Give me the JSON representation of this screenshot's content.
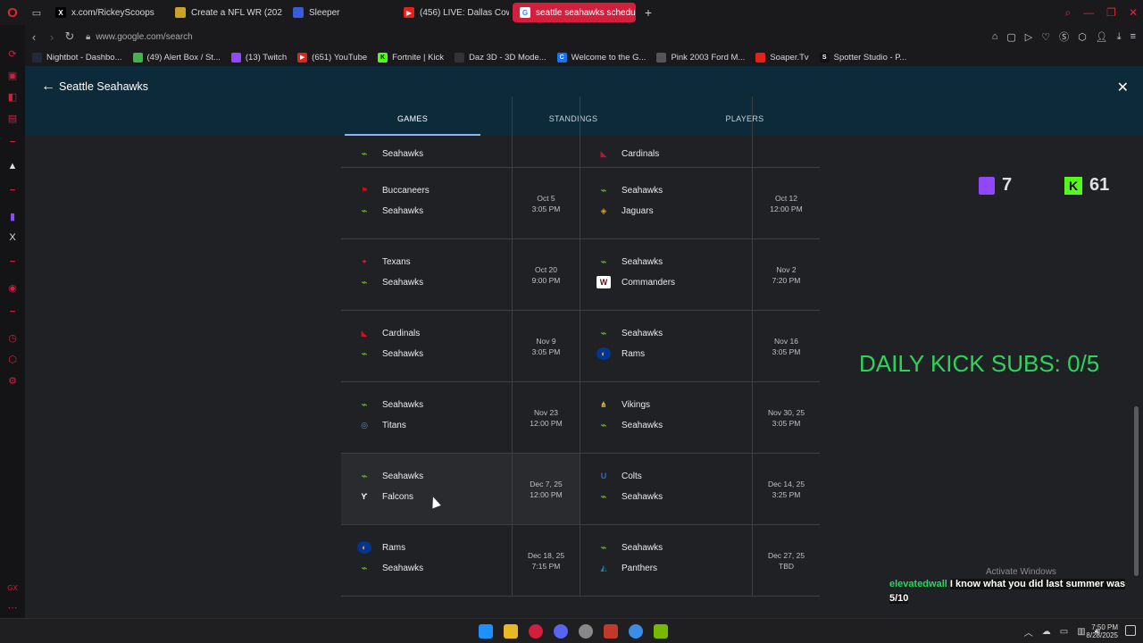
{
  "browser": {
    "tabs": [
      {
        "label": "x.com/RickeyScoops",
        "icon": "x-logo-icon",
        "color": "#000000",
        "glyph": "X",
        "active": false
      },
      {
        "label": "Create a NFL WR (2025-2",
        "icon": "yellow-tab-icon",
        "color": "#c9a227",
        "glyph": "",
        "active": false
      },
      {
        "label": "Sleeper",
        "icon": "sleeper-icon",
        "color": "#3a5bd6",
        "glyph": "",
        "active": false
      },
      {
        "label": "(456) LIVE: Dallas Cowbo",
        "icon": "youtube-icon",
        "color": "#e62117",
        "glyph": "▶",
        "active": false
      },
      {
        "label": "seattle seahawks schedul",
        "icon": "google-icon",
        "color": "#ffffff",
        "glyph": "G",
        "active": true
      }
    ],
    "url": "www.google.com/search",
    "bookmarks": [
      {
        "label": "Nightbot - Dashbo...",
        "color": "#222a3a",
        "glyph": ""
      },
      {
        "label": "(49) Alert Box / St...",
        "color": "#42b549",
        "glyph": ""
      },
      {
        "label": "(13) Twitch",
        "color": "#9146ff",
        "glyph": ""
      },
      {
        "label": "(651) YouTube",
        "color": "#e62117",
        "glyph": "▶"
      },
      {
        "label": "Fortnite | Kick",
        "color": "#53fc18",
        "glyph": "K"
      },
      {
        "label": "Daz 3D - 3D Mode...",
        "color": "#333333",
        "glyph": ""
      },
      {
        "label": "Welcome to the G...",
        "color": "#1a73e8",
        "glyph": "C"
      },
      {
        "label": "Pink 2003 Ford M...",
        "color": "#555555",
        "glyph": ""
      },
      {
        "label": "Soaper.Tv",
        "color": "#e62117",
        "glyph": ""
      },
      {
        "label": "Spotter Studio - P...",
        "color": "#111111",
        "glyph": "S"
      }
    ]
  },
  "panel": {
    "title": "Seattle Seahawks",
    "tabs": [
      "GAMES",
      "STANDINGS",
      "PLAYERS"
    ],
    "active_tab": "GAMES"
  },
  "games": [
    {
      "left": {
        "teams": [
          {
            "name": "Seahawks",
            "logo": "sea"
          }
        ],
        "date": "",
        "time": ""
      },
      "right": {
        "teams": [
          {
            "name": "Cardinals",
            "logo": "ari"
          }
        ],
        "date": "",
        "time": ""
      },
      "partial": true
    },
    {
      "left": {
        "teams": [
          {
            "name": "Buccaneers",
            "logo": "tb"
          },
          {
            "name": "Seahawks",
            "logo": "sea"
          }
        ],
        "date": "Oct 5",
        "time": "3:05 PM"
      },
      "right": {
        "teams": [
          {
            "name": "Seahawks",
            "logo": "sea"
          },
          {
            "name": "Jaguars",
            "logo": "jax"
          }
        ],
        "date": "Oct 12",
        "time": "12:00 PM"
      }
    },
    {
      "left": {
        "teams": [
          {
            "name": "Texans",
            "logo": "hou"
          },
          {
            "name": "Seahawks",
            "logo": "sea"
          }
        ],
        "date": "Oct 20",
        "time": "9:00 PM"
      },
      "right": {
        "teams": [
          {
            "name": "Seahawks",
            "logo": "sea"
          },
          {
            "name": "Commanders",
            "logo": "was"
          }
        ],
        "date": "Nov 2",
        "time": "7:20 PM"
      }
    },
    {
      "left": {
        "teams": [
          {
            "name": "Cardinals",
            "logo": "ari"
          },
          {
            "name": "Seahawks",
            "logo": "sea"
          }
        ],
        "date": "Nov 9",
        "time": "3:05 PM"
      },
      "right": {
        "teams": [
          {
            "name": "Seahawks",
            "logo": "sea"
          },
          {
            "name": "Rams",
            "logo": "lar"
          }
        ],
        "date": "Nov 16",
        "time": "3:05 PM"
      }
    },
    {
      "left": {
        "teams": [
          {
            "name": "Seahawks",
            "logo": "sea"
          },
          {
            "name": "Titans",
            "logo": "ten"
          }
        ],
        "date": "Nov 23",
        "time": "12:00 PM"
      },
      "right": {
        "teams": [
          {
            "name": "Vikings",
            "logo": "min"
          },
          {
            "name": "Seahawks",
            "logo": "sea"
          }
        ],
        "date": "Nov 30, 25",
        "time": "3:05 PM"
      }
    },
    {
      "left": {
        "teams": [
          {
            "name": "Seahawks",
            "logo": "sea"
          },
          {
            "name": "Falcons",
            "logo": "atl"
          }
        ],
        "date": "Dec 7, 25",
        "time": "12:00 PM",
        "hover": true
      },
      "right": {
        "teams": [
          {
            "name": "Colts",
            "logo": "ind"
          },
          {
            "name": "Seahawks",
            "logo": "sea"
          }
        ],
        "date": "Dec 14, 25",
        "time": "3:25 PM"
      }
    },
    {
      "left": {
        "teams": [
          {
            "name": "Rams",
            "logo": "lar"
          },
          {
            "name": "Seahawks",
            "logo": "sea"
          }
        ],
        "date": "Dec 18, 25",
        "time": "7:15 PM"
      },
      "right": {
        "teams": [
          {
            "name": "Seahawks",
            "logo": "sea"
          },
          {
            "name": "Panthers",
            "logo": "car"
          }
        ],
        "date": "Dec 27, 25",
        "time": "TBD"
      }
    }
  ],
  "overlay": {
    "twitch_viewers": "7",
    "kick_viewers": "61",
    "daily_subs": "DAILY KICK SUBS: 0/5",
    "activate_windows": "Activate Windows",
    "chat_user": "elevatedwall",
    "chat_message": "I know what you did last summer was 5/10"
  },
  "taskbar": {
    "time": "7:50 PM",
    "date": "8/28/2025"
  },
  "colors": {
    "accent": "#d11f3d",
    "panel_header": "#0d2a3a",
    "tab_underline": "#8ab4f8",
    "kick_green": "#53fc18",
    "twitch_purple": "#9146ff"
  }
}
